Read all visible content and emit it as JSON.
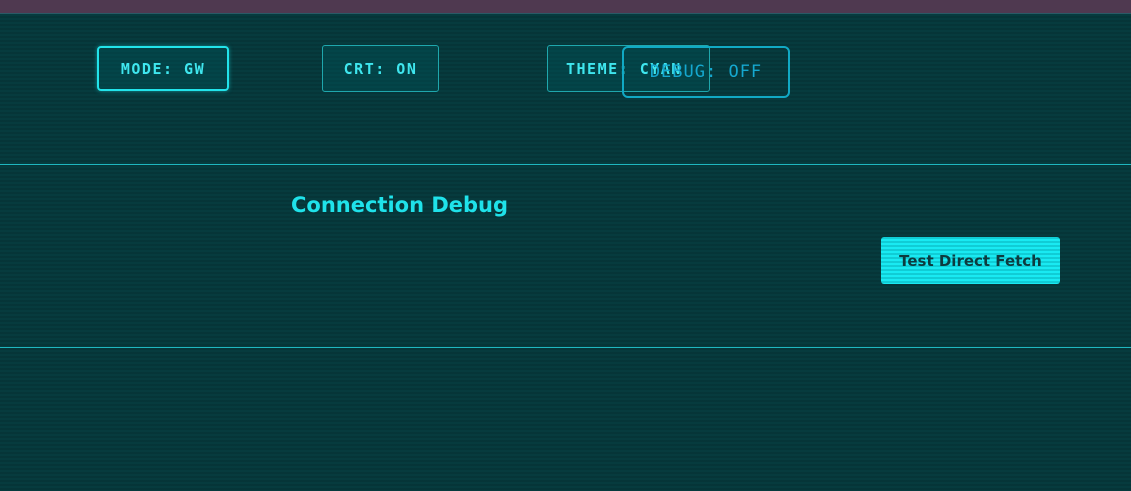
{
  "controls": {
    "mode_label": "MODE: GW",
    "crt_label": "CRT: ON",
    "theme_label": "THEME: CYAN",
    "debug_label": "DEBUG: OFF"
  },
  "debug_panel": {
    "title": "Connection Debug",
    "test_fetch_label": "Test Direct Fetch"
  },
  "colors": {
    "background": "#063b3e",
    "accent": "#1fe2ea",
    "debug_accent": "#11a9c4",
    "top_bar": "#4f3950"
  }
}
